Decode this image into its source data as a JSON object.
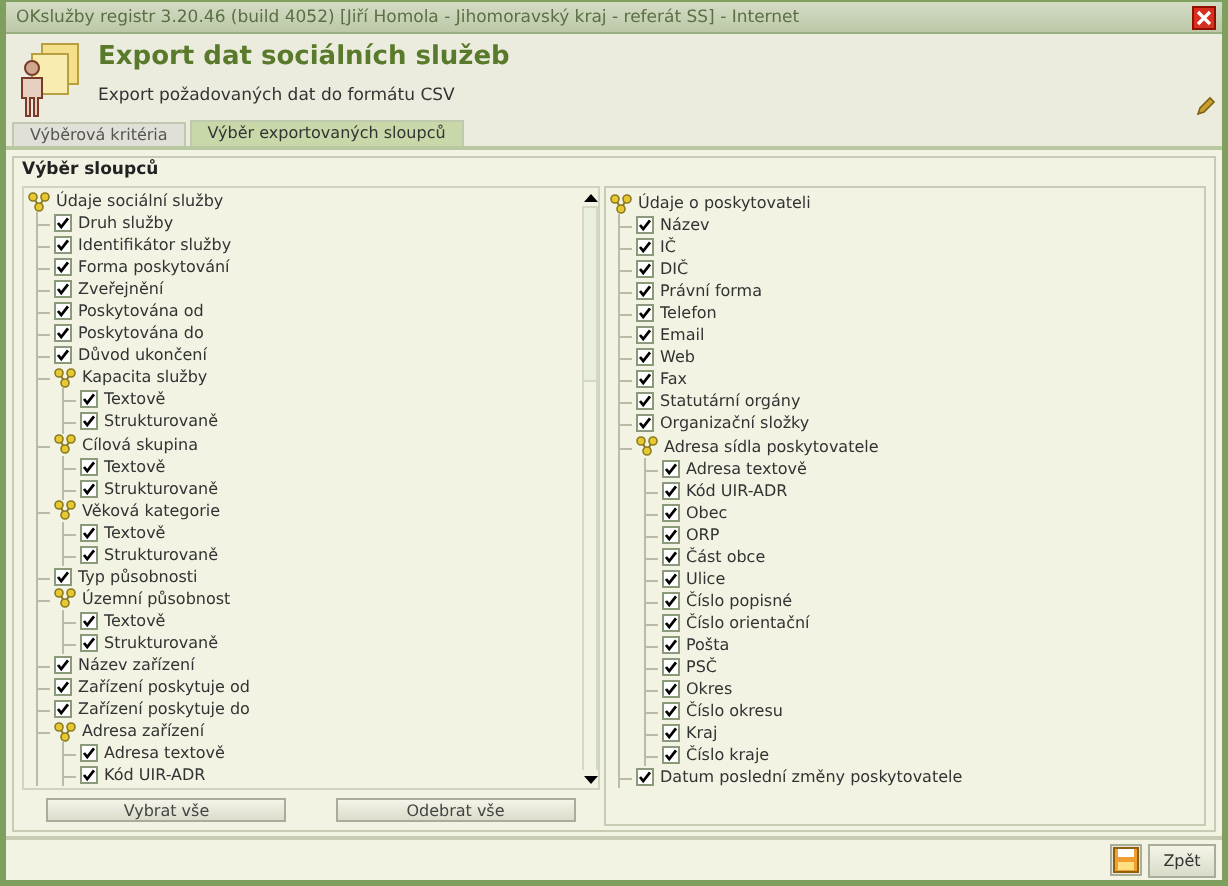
{
  "window": {
    "title": "OKslužby registr 3.20.46 (build 4052)  [Jiří Homola - Jihomoravský kraj - referát SS] - Internet"
  },
  "header": {
    "title": "Export dat sociálních služeb",
    "subtitle": "Export požadovaných dat do formátu CSV"
  },
  "tabs": [
    {
      "label": "Výběrová kritéria",
      "selected": false
    },
    {
      "label": "Výběr exportovaných sloupců",
      "selected": true
    }
  ],
  "group_title": "Výběr sloupců",
  "left_tree": {
    "label": "Údaje sociální služby",
    "kind": "group",
    "children": [
      {
        "label": "Druh služby",
        "kind": "check",
        "checked": true
      },
      {
        "label": "Identifikátor služby",
        "kind": "check",
        "checked": true
      },
      {
        "label": "Forma poskytování",
        "kind": "check",
        "checked": true
      },
      {
        "label": "Zveřejnění",
        "kind": "check",
        "checked": true
      },
      {
        "label": "Poskytována od",
        "kind": "check",
        "checked": true
      },
      {
        "label": "Poskytována do",
        "kind": "check",
        "checked": true
      },
      {
        "label": "Důvod ukončení",
        "kind": "check",
        "checked": true
      },
      {
        "label": "Kapacita služby",
        "kind": "group",
        "children": [
          {
            "label": "Textově",
            "kind": "check",
            "checked": true
          },
          {
            "label": "Strukturovaně",
            "kind": "check",
            "checked": true
          }
        ]
      },
      {
        "label": "Cílová skupina",
        "kind": "group",
        "children": [
          {
            "label": "Textově",
            "kind": "check",
            "checked": true
          },
          {
            "label": "Strukturovaně",
            "kind": "check",
            "checked": true
          }
        ]
      },
      {
        "label": "Věková kategorie",
        "kind": "group",
        "children": [
          {
            "label": "Textově",
            "kind": "check",
            "checked": true
          },
          {
            "label": "Strukturovaně",
            "kind": "check",
            "checked": true
          }
        ]
      },
      {
        "label": "Typ působnosti",
        "kind": "check",
        "checked": true
      },
      {
        "label": "Územní působnost",
        "kind": "group",
        "children": [
          {
            "label": "Textově",
            "kind": "check",
            "checked": true
          },
          {
            "label": "Strukturovaně",
            "kind": "check",
            "checked": true
          }
        ]
      },
      {
        "label": "Název zařízení",
        "kind": "check",
        "checked": true
      },
      {
        "label": "Zařízení poskytuje od",
        "kind": "check",
        "checked": true
      },
      {
        "label": "Zařízení poskytuje do",
        "kind": "check",
        "checked": true
      },
      {
        "label": "Adresa zařízení",
        "kind": "group",
        "children": [
          {
            "label": "Adresa textově",
            "kind": "check",
            "checked": true
          },
          {
            "label": "Kód UIR-ADR",
            "kind": "check",
            "checked": true
          }
        ]
      }
    ]
  },
  "right_tree": {
    "label": "Údaje o poskytovateli",
    "kind": "group",
    "children": [
      {
        "label": "Název",
        "kind": "check",
        "checked": true
      },
      {
        "label": "IČ",
        "kind": "check",
        "checked": true
      },
      {
        "label": "DIČ",
        "kind": "check",
        "checked": true
      },
      {
        "label": "Právní forma",
        "kind": "check",
        "checked": true
      },
      {
        "label": "Telefon",
        "kind": "check",
        "checked": true
      },
      {
        "label": "Email",
        "kind": "check",
        "checked": true
      },
      {
        "label": "Web",
        "kind": "check",
        "checked": true
      },
      {
        "label": "Fax",
        "kind": "check",
        "checked": true
      },
      {
        "label": "Statutární orgány",
        "kind": "check",
        "checked": true
      },
      {
        "label": "Organizační složky",
        "kind": "check",
        "checked": true
      },
      {
        "label": "Adresa sídla poskytovatele",
        "kind": "group",
        "children": [
          {
            "label": "Adresa textově",
            "kind": "check",
            "checked": true
          },
          {
            "label": "Kód UIR-ADR",
            "kind": "check",
            "checked": true
          },
          {
            "label": "Obec",
            "kind": "check",
            "checked": true
          },
          {
            "label": "ORP",
            "kind": "check",
            "checked": true
          },
          {
            "label": "Část obce",
            "kind": "check",
            "checked": true
          },
          {
            "label": "Ulice",
            "kind": "check",
            "checked": true
          },
          {
            "label": "Číslo popisné",
            "kind": "check",
            "checked": true
          },
          {
            "label": "Číslo orientační",
            "kind": "check",
            "checked": true
          },
          {
            "label": "Pošta",
            "kind": "check",
            "checked": true
          },
          {
            "label": "PSČ",
            "kind": "check",
            "checked": true
          },
          {
            "label": "Okres",
            "kind": "check",
            "checked": true
          },
          {
            "label": "Číslo okresu",
            "kind": "check",
            "checked": true
          },
          {
            "label": "Kraj",
            "kind": "check",
            "checked": true
          },
          {
            "label": "Číslo kraje",
            "kind": "check",
            "checked": true
          }
        ]
      },
      {
        "label": "Datum poslední změny poskytovatele",
        "kind": "check",
        "checked": true
      }
    ]
  },
  "select_buttons": [
    "Vybrat vše",
    "Odebrat vše"
  ],
  "footer": {
    "back_button": "Zpět"
  }
}
